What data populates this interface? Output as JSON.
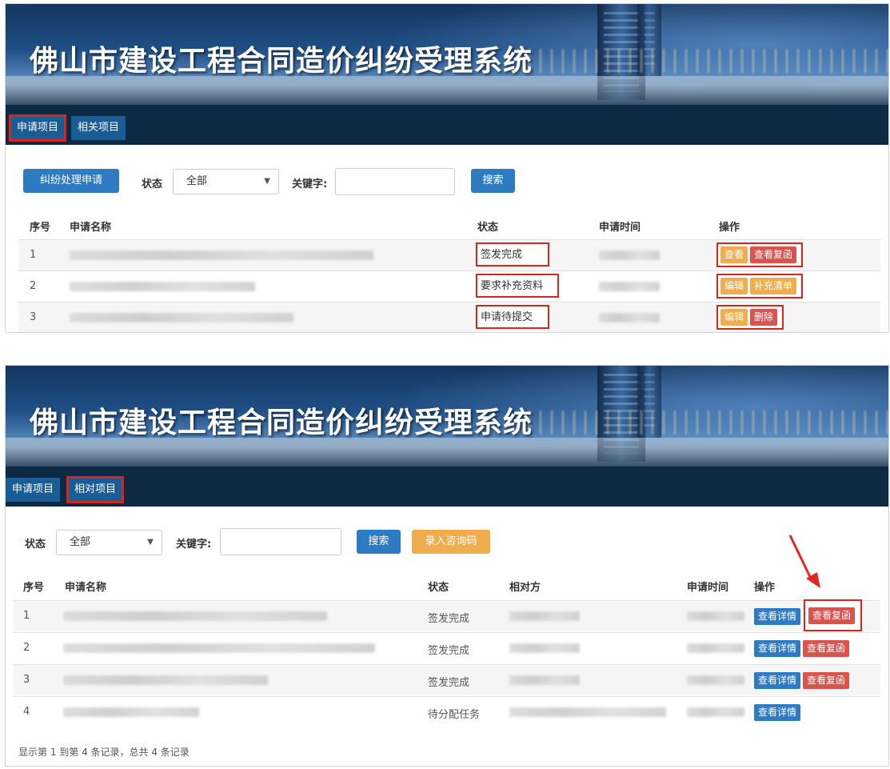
{
  "app_title": "佛山市建设工程合同造价纠纷受理系统",
  "colors": {
    "nav_bg": "#0d2a45",
    "tab_bg": "#1a5c94",
    "primary": "#2f7bc1",
    "warning": "#f0ad4e",
    "danger": "#d9534f",
    "highlight": "#d9261c"
  },
  "panel1": {
    "tabs": [
      "申请项目",
      "相关项目"
    ],
    "active_tab": "申请项目",
    "apply_button": "纠纷处理申请",
    "status_label": "状态",
    "status_value": "全部",
    "keyword_label": "关键字:",
    "search_button": "搜索",
    "columns": [
      "序号",
      "申请名称",
      "状态",
      "申请时间",
      "操作"
    ],
    "rows": [
      {
        "no": "1",
        "status": "签发完成",
        "actions": [
          "查看",
          "查看复函"
        ]
      },
      {
        "no": "2",
        "status": "要求补充资料",
        "actions": [
          "编辑",
          "补充清单"
        ]
      },
      {
        "no": "3",
        "status": "申请待提交",
        "actions": [
          "编辑",
          "删除"
        ]
      }
    ]
  },
  "panel2": {
    "tabs": [
      "申请项目",
      "相对项目"
    ],
    "active_tab": "相对项目",
    "status_label": "状态",
    "status_value": "全部",
    "keyword_label": "关键字:",
    "search_button": "搜索",
    "consult_button": "录入咨询码",
    "columns": [
      "序号",
      "申请名称",
      "状态",
      "相对方",
      "申请时间",
      "操作"
    ],
    "rows": [
      {
        "no": "1",
        "status": "签发完成",
        "actions": [
          "查看详情",
          "查看复函"
        ]
      },
      {
        "no": "2",
        "status": "签发完成",
        "actions": [
          "查看详情",
          "查看复函"
        ]
      },
      {
        "no": "3",
        "status": "签发完成",
        "actions": [
          "查看详情",
          "查看复函"
        ]
      },
      {
        "no": "4",
        "status": "待分配任务",
        "actions": [
          "查看详情"
        ]
      }
    ],
    "footer": "显示第 1 到第 4 条记录，总共 4 条记录"
  }
}
